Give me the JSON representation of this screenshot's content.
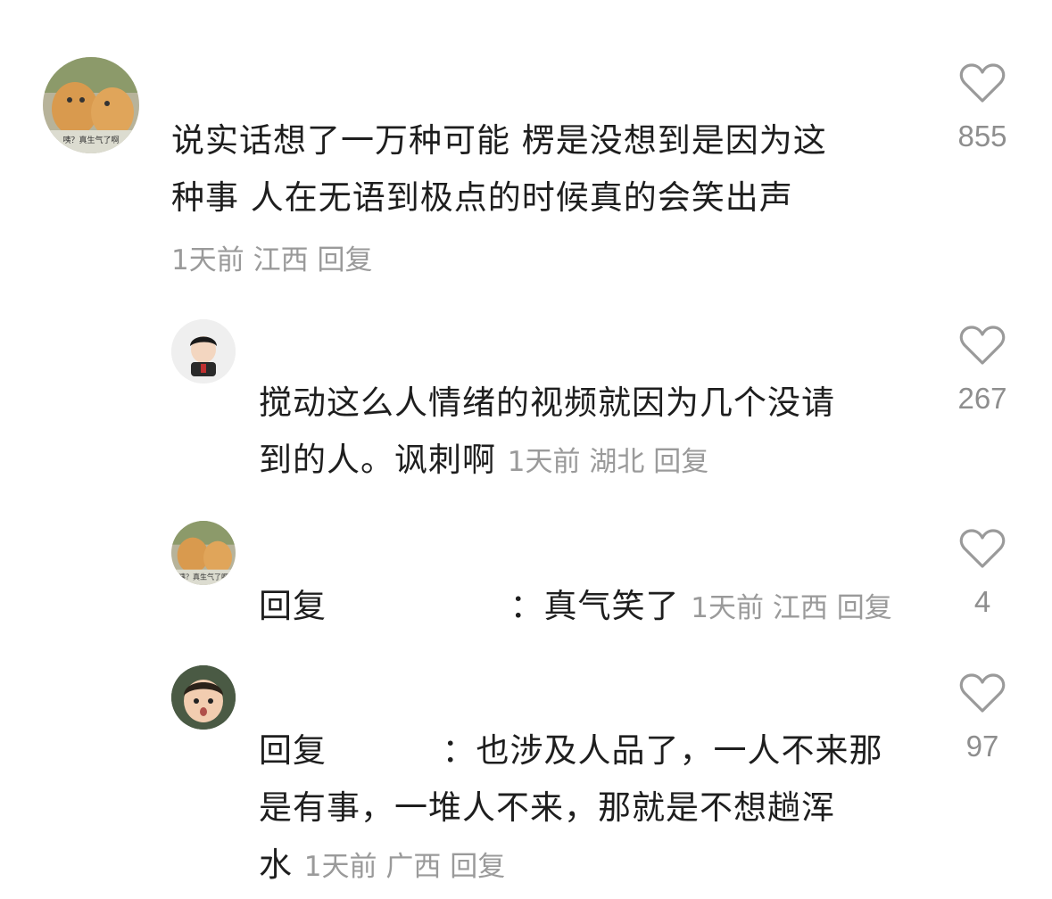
{
  "comments": [
    {
      "text_line1": "说实话想了一万种可能 楞是没想到是因为这",
      "text_line2": "种事 人在无语到极点的时候真的会笑出声",
      "time": "1天前",
      "location": "江西",
      "reply_label": "回复",
      "likes": "855",
      "avatar_caption": "咦？真生气了啊"
    },
    {
      "text_line1": "搅动这么人情绪的视频就因为几个没请",
      "text_line2": "到的人。讽刺啊",
      "time": "1天前",
      "location": "湖北",
      "reply_label": "回复",
      "likes": "267"
    },
    {
      "prefix": "回复",
      "text": "：真气笑了",
      "time": "1天前",
      "location": "江西",
      "reply_label": "回复",
      "likes": "4",
      "avatar_caption": "咦？真生气了啊"
    },
    {
      "prefix": "回复",
      "text_line1": "：也涉及人品了，一人不来那",
      "text_line2": "是有事，一堆人不来，那就是不想趟浑",
      "text_line3": "水",
      "time": "1天前",
      "location": "广西",
      "reply_label": "回复",
      "likes": "97"
    }
  ],
  "icons": {
    "like": "heart-outline-icon"
  },
  "colors": {
    "text": "#1e1e1e",
    "meta": "#9a9a9a",
    "like_count": "#8e8e8e"
  }
}
